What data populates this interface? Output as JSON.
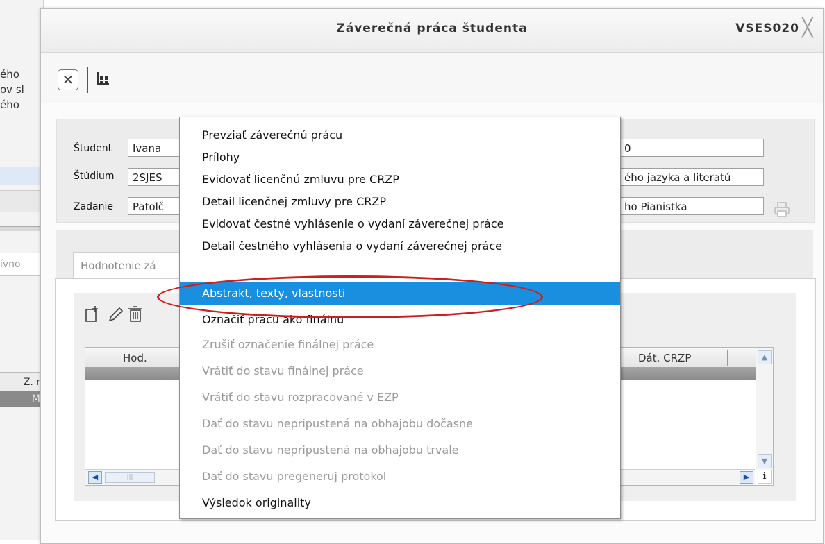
{
  "background_window": {
    "lines": [
      "ého",
      "ov sl",
      "ého"
    ],
    "tab_label": "ívno",
    "header_cells": [
      "Z. r",
      "M"
    ]
  },
  "dialog": {
    "title": "Záverečná práca študenta",
    "form_code": "VSES020",
    "close_glyph": "╳"
  },
  "toolbar": {
    "close_glyph": "✕",
    "tree_glyph": "ᚄ"
  },
  "info": {
    "student_label": "Študent",
    "student_value": "Ivana",
    "student_right_value": "0",
    "study_label": "Štúdium",
    "study_value": "2SJES",
    "study_right_value": "ého jazyka a literatú",
    "assignment_label": "Zadanie",
    "assignment_value": "Patolč",
    "assignment_right_value": "ho Pianistka"
  },
  "tabs": {
    "active_label": "Hodnotenie zá"
  },
  "grid": {
    "icons": [
      "new-record-icon",
      "edit-icon",
      "delete-icon"
    ],
    "icon_glyphs": "⎘✎🗑",
    "columns": [
      "Hod.",
      "Dát. CRZP"
    ],
    "info_glyph": "i"
  },
  "context_menu": {
    "items": [
      {
        "label": "Prevziať záverečnú prácu",
        "state": "enabled"
      },
      {
        "label": "Prílohy",
        "state": "enabled"
      },
      {
        "label": "Evidovať licenčnú zmluvu pre CRZP",
        "state": "enabled"
      },
      {
        "label": "Detail licenčnej zmluvy pre CRZP",
        "state": "enabled"
      },
      {
        "label": "Evidovať čestné vyhlásenie o vydaní záverečnej práce",
        "state": "enabled"
      },
      {
        "label": "Detail čestného vyhlásenia o vydaní záverečnej práce",
        "state": "enabled"
      },
      {
        "label": "Abstrakt, texty, vlastnosti",
        "state": "selected"
      },
      {
        "label": "Označiť prácu ako finálnu",
        "state": "enabled"
      },
      {
        "label": "Zrušiť označenie finálnej práce",
        "state": "disabled"
      },
      {
        "label": "Vrátiť do stavu finálnej práce",
        "state": "disabled"
      },
      {
        "label": "Vrátiť do stavu rozpracované v EZP",
        "state": "disabled"
      },
      {
        "label": "Dať do stavu nepripustená na obhajobu dočasne",
        "state": "disabled"
      },
      {
        "label": "Dať do stavu nepripustená na obhajobu trvale",
        "state": "disabled"
      },
      {
        "label": "Dať do stavu pregeneruj protokol",
        "state": "disabled"
      },
      {
        "label": "Výsledok originality",
        "state": "enabled"
      }
    ],
    "highlight_color": "#1a8fe0",
    "annotation_color": "#cc1f1f"
  }
}
